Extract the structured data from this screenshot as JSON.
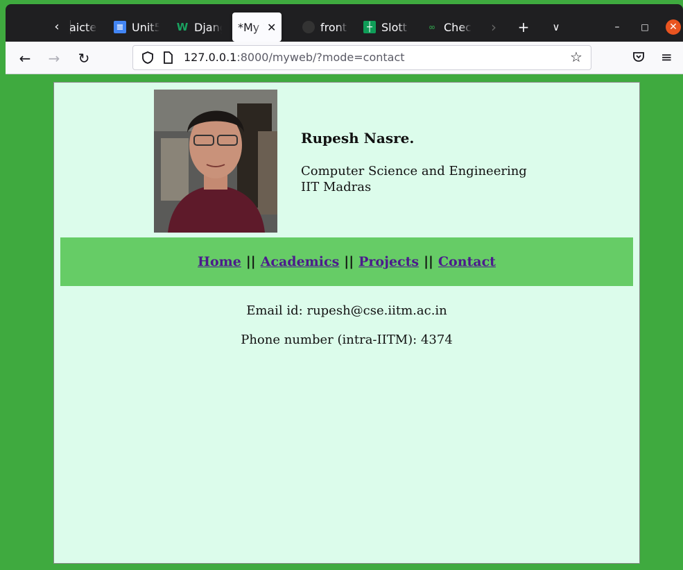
{
  "browser": {
    "tabs": [
      {
        "title": "aicte",
        "icon": "none"
      },
      {
        "title": "Unit5",
        "icon": "docs-icon"
      },
      {
        "title": "Django",
        "icon": "w-icon"
      },
      {
        "title": "*My Web",
        "icon": "none",
        "active": true
      },
      {
        "title": "front",
        "icon": "github-icon"
      },
      {
        "title": "Slott",
        "icon": "sheets-icon"
      },
      {
        "title": "Chec",
        "icon": "geeks-icon"
      }
    ],
    "url_host": "127.0.0.1",
    "url_rest": ":8000/myweb/?mode=contact",
    "colors": {
      "tabstrip": "#1f1f21",
      "toolbar": "#f9f9fb",
      "page_bg": "#3faa3f"
    }
  },
  "profile": {
    "name": "Rupesh Nasre.",
    "dept_line1": "Computer Science and Engineering",
    "dept_line2": "IIT Madras"
  },
  "nav": {
    "home": "Home",
    "academics": "Academics",
    "projects": "Projects",
    "contact": "Contact",
    "separator": "||"
  },
  "contact": {
    "email": "Email id: rupesh@cse.iitm.ac.in",
    "phone": "Phone number (intra-IITM): 4374"
  },
  "colors": {
    "content_bg": "#dcfceb",
    "nav_bg": "#66cc66",
    "link": "#4b1b8c"
  }
}
